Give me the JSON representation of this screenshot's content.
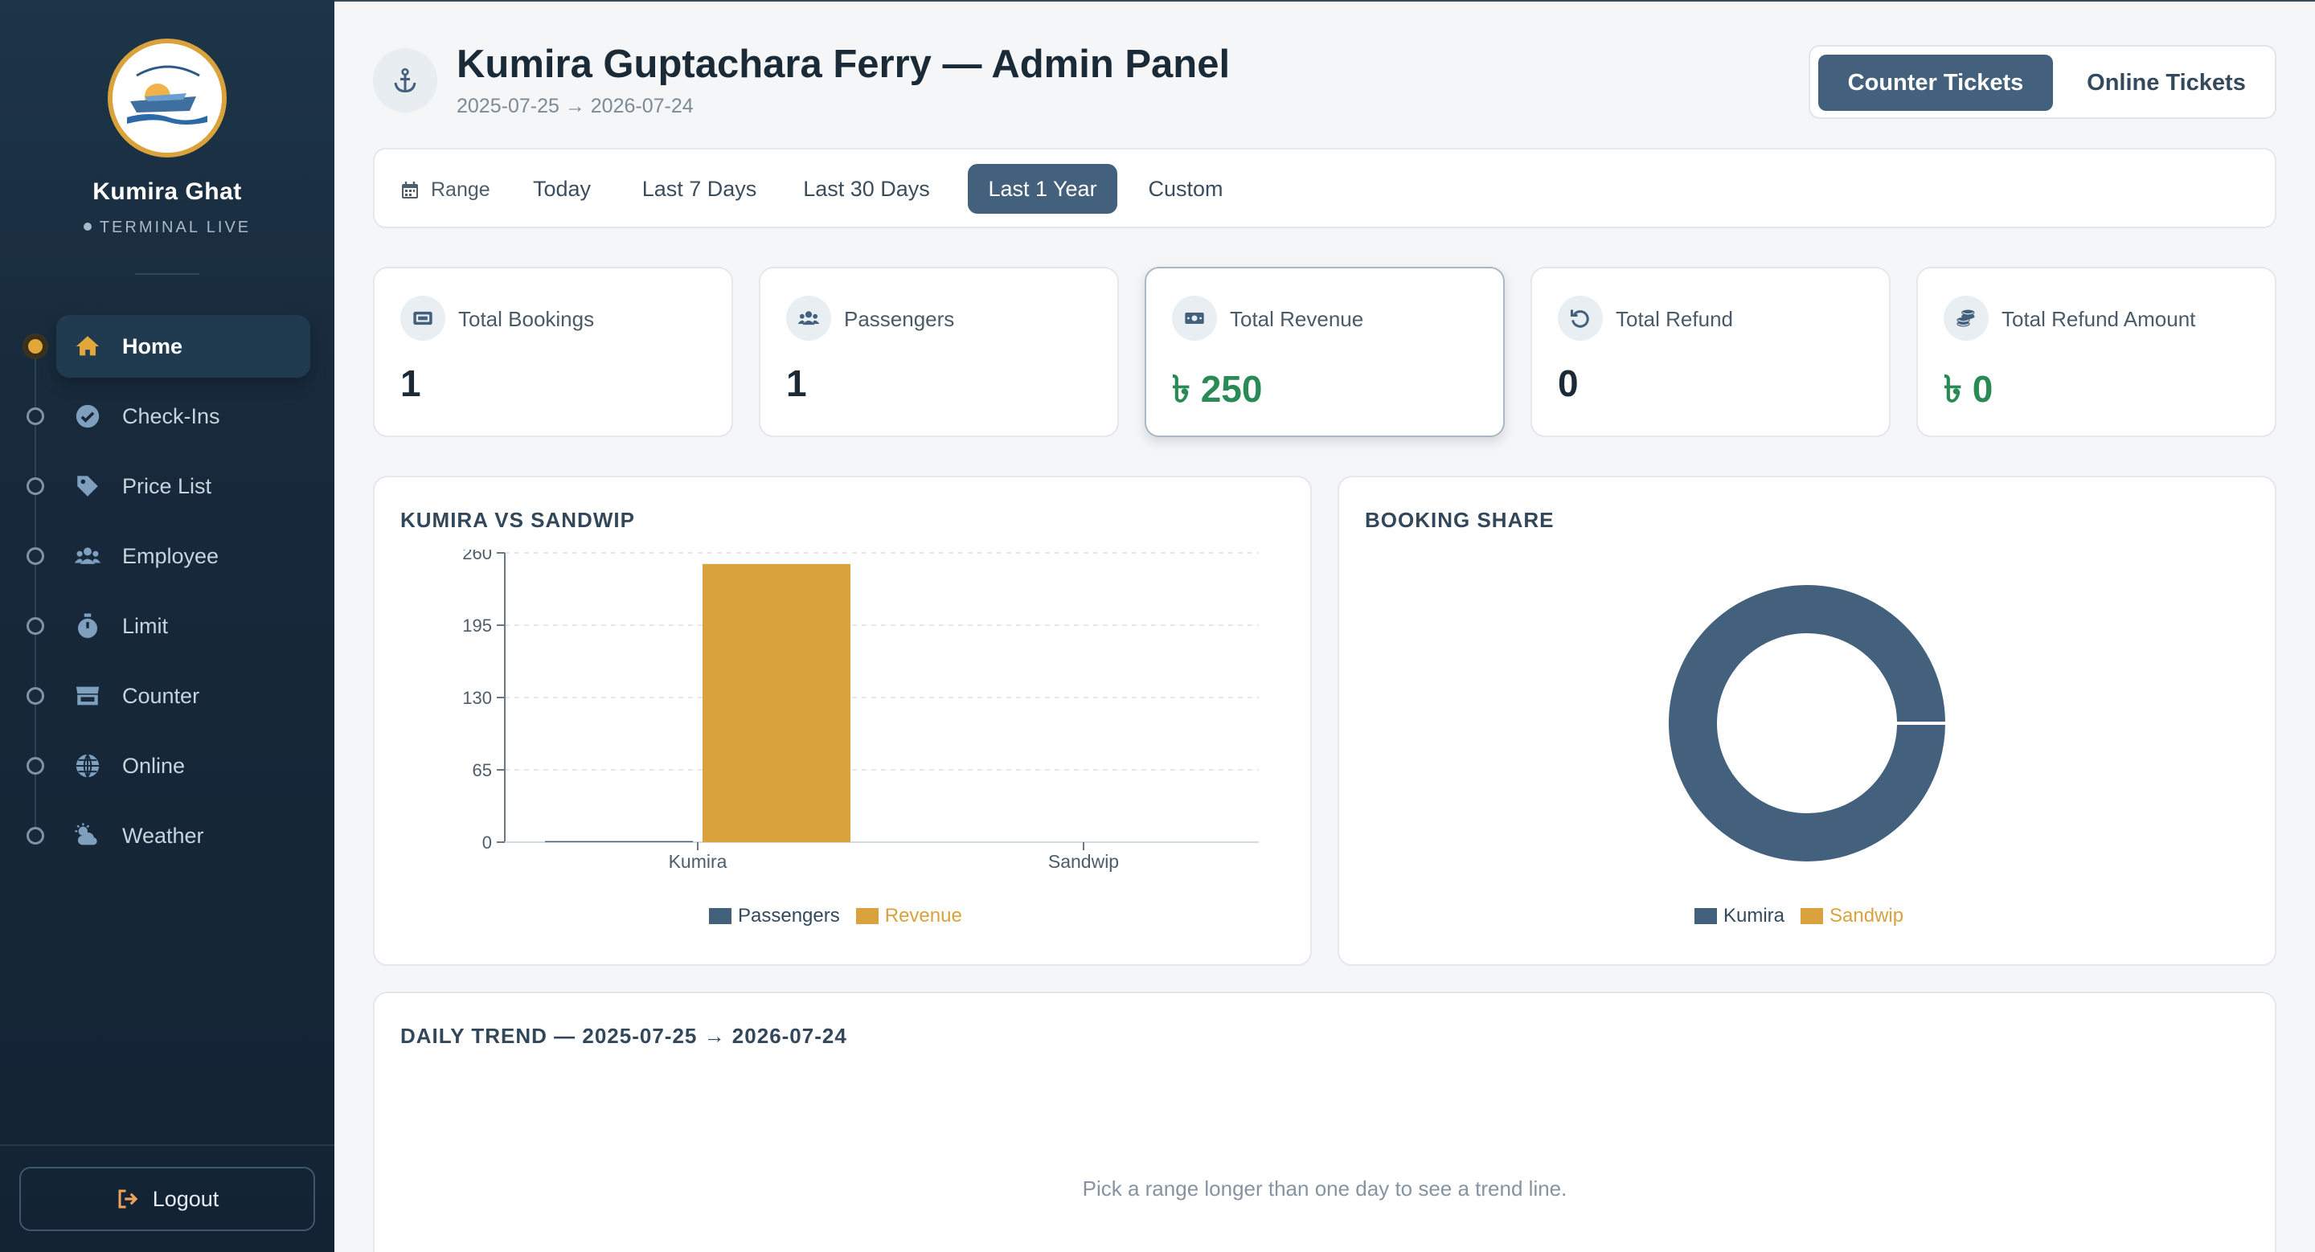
{
  "sidebar": {
    "brand_name": "Kumira Ghat",
    "brand_status": "TERMINAL LIVE",
    "items": [
      {
        "label": "Home",
        "icon": "home-icon",
        "active": true
      },
      {
        "label": "Check-Ins",
        "icon": "check-circle-icon",
        "active": false
      },
      {
        "label": "Price List",
        "icon": "tag-icon",
        "active": false
      },
      {
        "label": "Employee",
        "icon": "users-icon",
        "active": false
      },
      {
        "label": "Limit",
        "icon": "stopwatch-icon",
        "active": false
      },
      {
        "label": "Counter",
        "icon": "store-icon",
        "active": false
      },
      {
        "label": "Online",
        "icon": "globe-icon",
        "active": false
      },
      {
        "label": "Weather",
        "icon": "cloud-sun-icon",
        "active": false
      }
    ],
    "logout_label": "Logout"
  },
  "header": {
    "title": "Kumira Guptachara Ferry — Admin Panel",
    "subtitle": "2025-07-25 → 2026-07-24",
    "ticket_tabs": [
      {
        "label": "Counter Tickets",
        "selected": true
      },
      {
        "label": "Online Tickets",
        "selected": false
      }
    ]
  },
  "range": {
    "label": "Range",
    "options": [
      {
        "label": "Today",
        "selected": false
      },
      {
        "label": "Last 7 Days",
        "selected": false
      },
      {
        "label": "Last 30 Days",
        "selected": false
      },
      {
        "label": "Last 1 Year",
        "selected": true
      },
      {
        "label": "Custom",
        "selected": false
      }
    ]
  },
  "stats": [
    {
      "label": "Total Bookings",
      "value": "1",
      "icon": "ticket-icon"
    },
    {
      "label": "Passengers",
      "value": "1",
      "icon": "users-icon"
    },
    {
      "label": "Total Revenue",
      "value": "৳ 250",
      "icon": "cash-icon"
    },
    {
      "label": "Total Refund",
      "value": "0",
      "icon": "undo-icon"
    },
    {
      "label": "Total Refund Amount",
      "value": "৳ 0",
      "icon": "coins-icon"
    }
  ],
  "colors": {
    "primary": "#43617d",
    "accent": "#d9a23d",
    "money": "#2a8a55",
    "sidebar_bg": "#17293a"
  },
  "chart_data": [
    {
      "type": "bar",
      "title": "KUMIRA VS SANDWIP",
      "categories": [
        "Kumira",
        "Sandwip"
      ],
      "series": [
        {
          "name": "Passengers",
          "values": [
            1,
            0
          ],
          "color": "#43617d"
        },
        {
          "name": "Revenue",
          "values": [
            250,
            0
          ],
          "color": "#d9a23d"
        }
      ],
      "yticks": [
        "0",
        "65",
        "130",
        "195",
        "260"
      ],
      "ylim": [
        0,
        260
      ],
      "grid": true,
      "legend": "bottom"
    },
    {
      "type": "pie",
      "title": "BOOKING SHARE",
      "labels": [
        "Kumira",
        "Sandwip"
      ],
      "values": [
        1,
        0
      ],
      "colors": [
        "#43617d",
        "#d9a23d"
      ],
      "donut": true,
      "legend": "bottom"
    }
  ],
  "trend": {
    "title": "DAILY TREND — 2025-07-25 → 2026-07-24",
    "message": "Pick a range longer than one day to see a trend line."
  }
}
